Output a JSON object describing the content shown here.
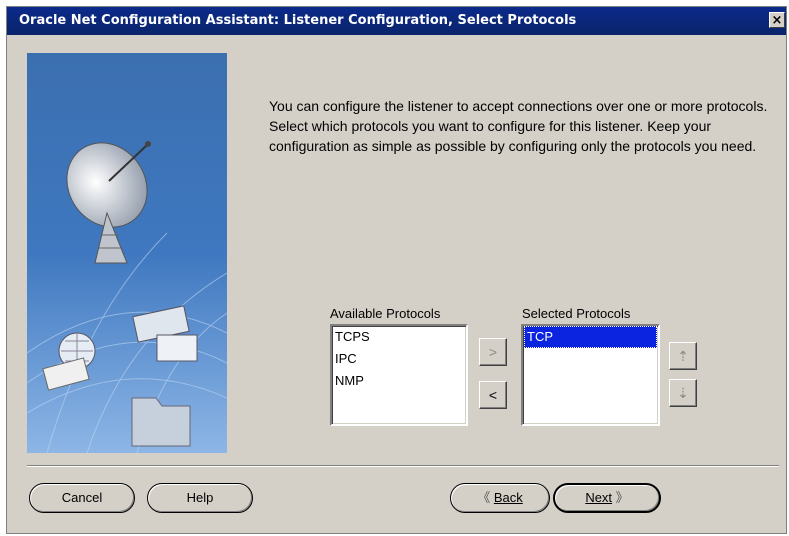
{
  "window": {
    "title": "Oracle Net Configuration Assistant: Listener Configuration, Select Protocols",
    "close_label": "×"
  },
  "description": "You can configure the listener to accept connections over one or more protocols. Select which protocols you want to configure for this listener. Keep your configuration as simple as possible by configuring only the protocols you need.",
  "available": {
    "label": "Available Protocols",
    "items": [
      "TCPS",
      "IPC",
      "NMP"
    ]
  },
  "selected": {
    "label": "Selected Protocols",
    "items": [
      "TCP"
    ]
  },
  "transfer": {
    "add_glyph": ">",
    "remove_glyph": "<"
  },
  "order": {
    "up_glyph": "⇡",
    "down_glyph": "⇣"
  },
  "footer": {
    "cancel_label": "Cancel",
    "help_label": "Help",
    "back_glyph": "《",
    "back_label": "Back",
    "next_label": "Next",
    "next_glyph": "》"
  }
}
